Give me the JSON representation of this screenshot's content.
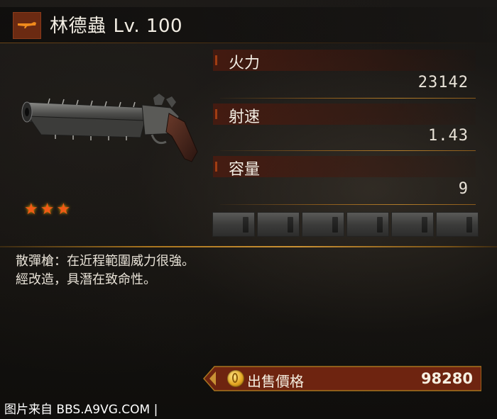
{
  "weapon": {
    "name": "林德蟲",
    "level_label": "Lv. 100",
    "rarity_stars": 3,
    "badge_icon": "shotgun-icon"
  },
  "stats": [
    {
      "label": "火力",
      "value": "23142"
    },
    {
      "label": "射速",
      "value": "1.43"
    },
    {
      "label": "容量",
      "value": "9"
    }
  ],
  "upgrade_slots": 6,
  "description": {
    "line1": "散彈槍：在近程範圍威力很強。",
    "line2": "經改造，具潛在致命性。"
  },
  "sell": {
    "label": "出售價格",
    "value": "98280",
    "icon": "coin-icon"
  },
  "watermark": "图片来自 BBS.A9VG.COM |",
  "colors": {
    "accent_orange": "#f05a16",
    "label_bar": "#501a0e",
    "divider_gold": "#c99134",
    "sell_bar": "#6e2410"
  }
}
